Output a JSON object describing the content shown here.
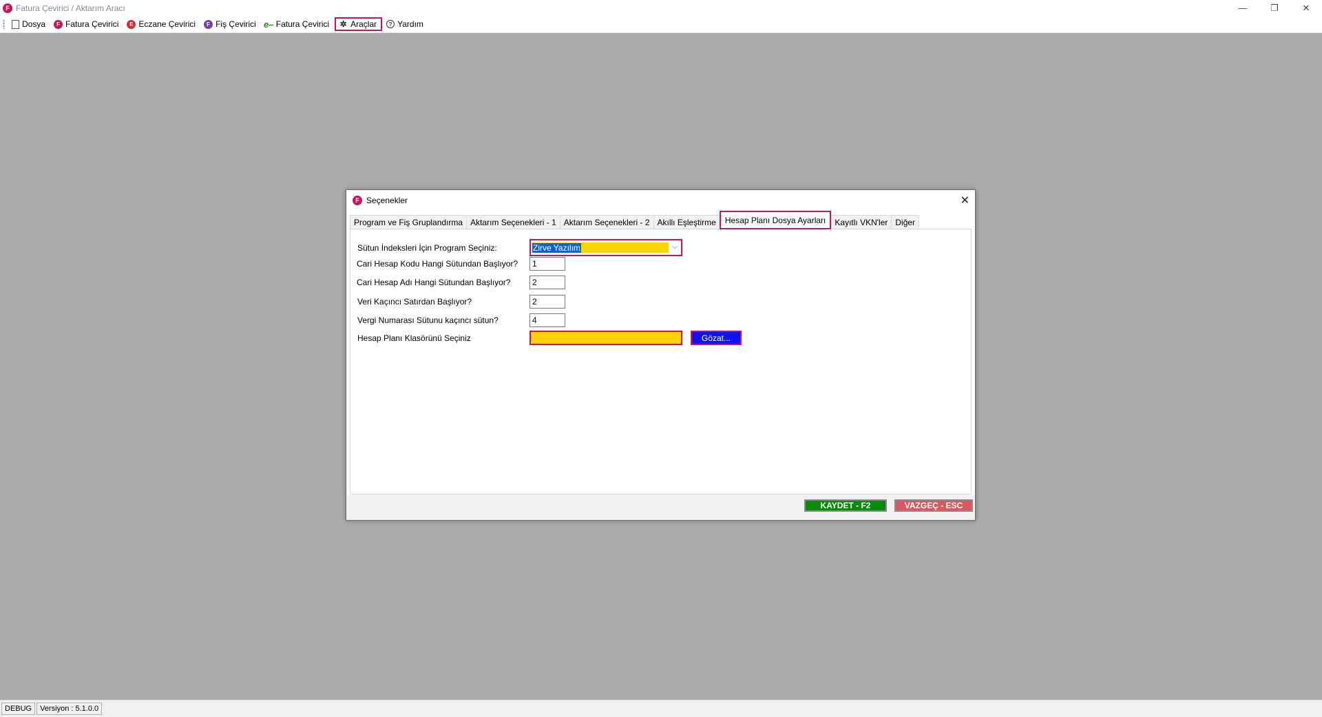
{
  "window": {
    "logo_letter": "F",
    "title": "Fatura Çevirici / Aktarım Aracı",
    "minimize": "—",
    "restore": "❐",
    "close": "✕"
  },
  "menu": {
    "items": [
      {
        "label": "Dosya",
        "icon": "document-icon"
      },
      {
        "label": "Fatura Çevirici",
        "icon": "fatura-icon",
        "icon_letter": "F"
      },
      {
        "label": "Eczane Çevirici",
        "icon": "eczane-icon",
        "icon_letter": "E"
      },
      {
        "label": "Fiş Çevirici",
        "icon": "fis-icon",
        "icon_letter": "F"
      },
      {
        "label": "Fatura Çevirici",
        "icon": "e-fatura-icon",
        "icon_letter": "e–"
      },
      {
        "label": "Araçlar",
        "icon": "tools-icon",
        "icon_letter": "✲",
        "active": true
      },
      {
        "label": "Yardım",
        "icon": "help-icon",
        "icon_letter": "?"
      }
    ]
  },
  "dialog": {
    "logo_letter": "F",
    "title": "Seçenekler",
    "close": "✕",
    "tabs": [
      "Program ve Fiş Gruplandırma",
      "Aktarım Seçenekleri - 1",
      "Aktarım Seçenekleri - 2",
      "Akıllı Eşleştirme",
      "Hesap Planı Dosya Ayarları",
      "Kayıtlı VKN'ler",
      "Diğer"
    ],
    "selected_tab": "Hesap Planı Dosya Ayarları",
    "form": {
      "program_label": "Sütun İndeksleri İçin Program Seçiniz:",
      "program_value": "Zirve Yazılım",
      "program_arrow": "⌵",
      "cari_kod_label": "Cari Hesap Kodu Hangi Sütundan Başlıyor?",
      "cari_kod_value": "1",
      "cari_adi_label": "Cari Hesap Adı Hangi Sütundan Başlıyor?",
      "cari_adi_value": "2",
      "veri_satir_label": "Veri Kaçıncı Satırdan Başlıyor?",
      "veri_satir_value": "2",
      "vergi_no_label": "Vergi Numarası Sütunu kaçıncı sütun?",
      "vergi_no_value": "4",
      "klasor_label": "Hesap Planı Klasörünü Seçiniz",
      "klasor_value": "",
      "browse_label": "Gözat..."
    },
    "save_label": "KAYDET - F2",
    "cancel_label": "VAZGEÇ - ESC"
  },
  "statusbar": {
    "mode": "DEBUG",
    "version": "Versiyon : 5.1.0.0"
  },
  "colors": {
    "highlight_border": "#c2185b",
    "field_fill": "#ffd200",
    "browse_button": "#1111ee",
    "save_button": "#0a8a0a",
    "cancel_button": "#d9595e",
    "workspace": "#ababab"
  }
}
